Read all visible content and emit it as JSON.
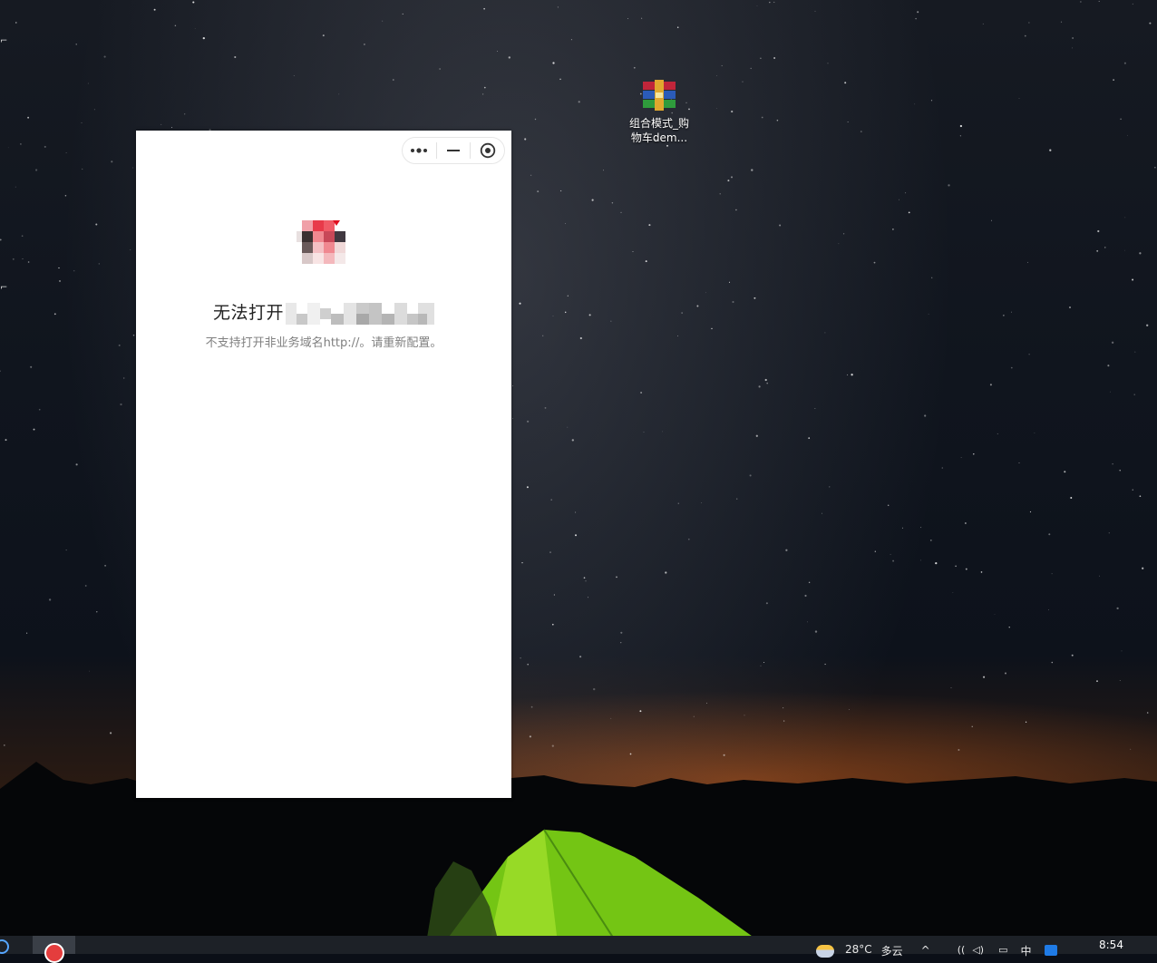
{
  "desktop": {
    "icons": [
      {
        "label_line1": "组合模式_购",
        "label_line2": "物车dem..."
      }
    ]
  },
  "mini_program": {
    "capsule": {
      "more_icon": "more-dots-icon",
      "minimize_icon": "minimize-icon",
      "close_icon": "target-close-icon"
    },
    "title": "无法打开",
    "description": "不支持打开非业务域名http://。请重新配置。"
  },
  "taskbar": {
    "weather_temp": "28°C",
    "weather_desc": "多云",
    "tray_overflow": "^",
    "ime": "中",
    "clock_time": "8:54"
  },
  "colors": {
    "window_bg": "#ffffff",
    "title_text": "#222222",
    "desc_text": "#808080",
    "taskbar_bg": "#1d2127"
  }
}
